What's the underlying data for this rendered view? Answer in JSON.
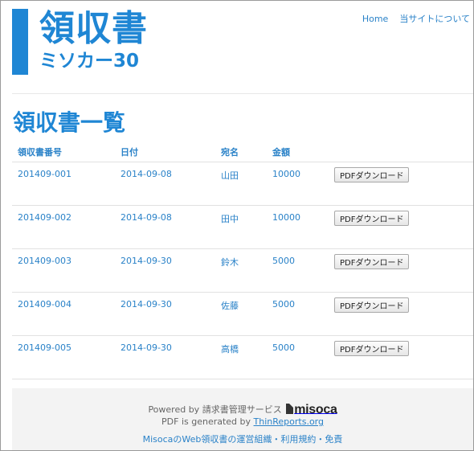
{
  "header": {
    "logo_title": "領収書",
    "logo_subtitle": "ミソカー30",
    "nav": [
      {
        "label": "Home"
      },
      {
        "label": "当サイトについて"
      }
    ]
  },
  "main": {
    "page_title": "領収書一覧",
    "table": {
      "columns": [
        "領収書番号",
        "日付",
        "宛名",
        "金額"
      ],
      "rows": [
        {
          "number": "201409-001",
          "date": "2014-09-08",
          "recipient": "山田",
          "amount": "10000",
          "action": "PDFダウンロード"
        },
        {
          "number": "201409-002",
          "date": "2014-09-08",
          "recipient": "田中",
          "amount": "10000",
          "action": "PDFダウンロード"
        },
        {
          "number": "201409-003",
          "date": "2014-09-30",
          "recipient": "鈴木",
          "amount": "5000",
          "action": "PDFダウンロード"
        },
        {
          "number": "201409-004",
          "date": "2014-09-30",
          "recipient": "佐藤",
          "amount": "5000",
          "action": "PDFダウンロード"
        },
        {
          "number": "201409-005",
          "date": "2014-09-30",
          "recipient": "高橋",
          "amount": "5000",
          "action": "PDFダウンロード"
        }
      ]
    }
  },
  "footer": {
    "powered_by": "Powered by 請求書管理サービス",
    "brand_name": "misoca",
    "pdf_generated_prefix": "PDF is generated by",
    "pdf_generator_link": "ThinReports.org",
    "links_text": "MisocaのWeb領収書の運営組織・利用規約・免責"
  },
  "colors": {
    "accent": "#1f86d4",
    "link": "#2a82c8",
    "footer_bg": "#f3f3f3"
  }
}
